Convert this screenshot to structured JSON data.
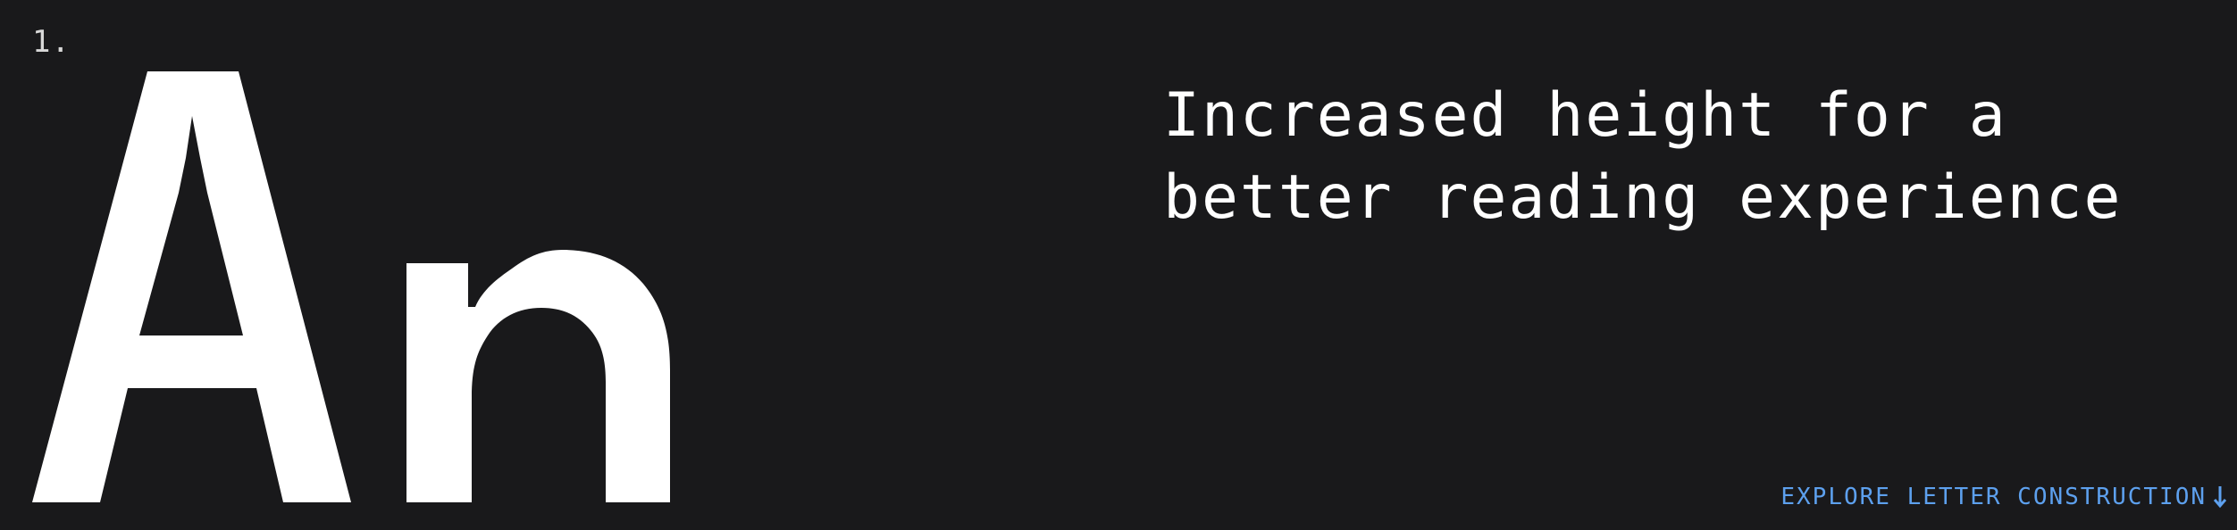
{
  "section": {
    "number": "1."
  },
  "specimen": {
    "glyphs": "An"
  },
  "headline": {
    "line1": "Increased height for a",
    "line2": "better reading experience"
  },
  "explore_link": {
    "label": "EXPLORE LETTER CONSTRUCTION",
    "icon": "arrow-down-icon"
  },
  "colors": {
    "background": "#19191b",
    "text": "#ffffff",
    "accent": "#5da0ee"
  }
}
